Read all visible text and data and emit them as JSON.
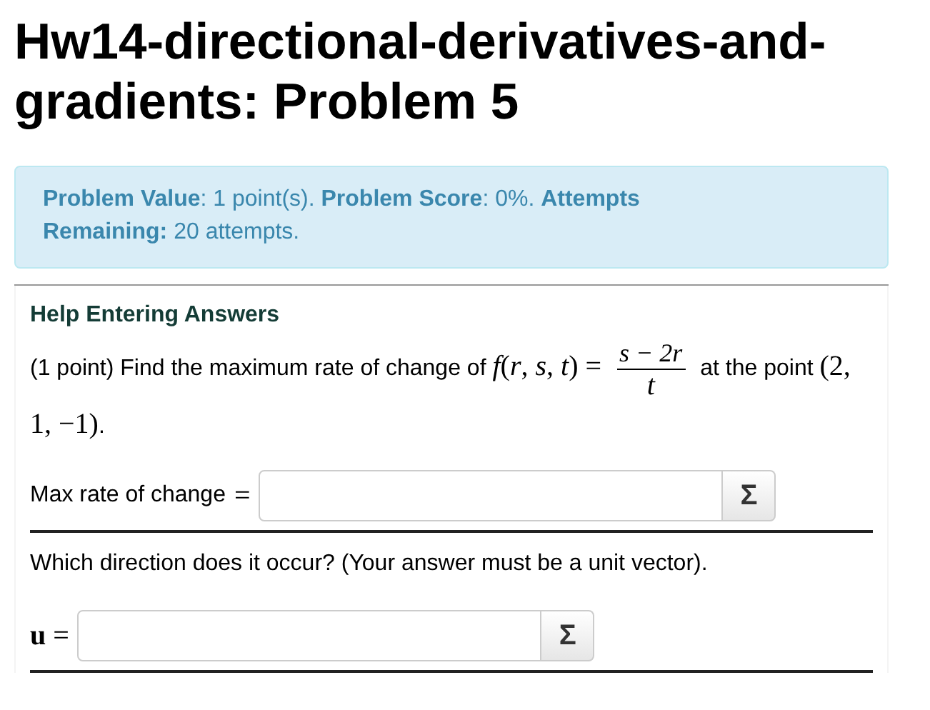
{
  "title": "Hw14-directional-derivatives-and-gradients: Problem 5",
  "status": "**Problem Value**: 1 point(s). **Problem Score**: 0%. **Attempts Remaining:** 20 attempts.",
  "help_link": "Help Entering Answers",
  "problem": {
    "intro": "(1 point) Find the maximum rate of change of",
    "function": "*f*(*r*, *s*, *t*) =",
    "numerator": "s − 2r",
    "denominator": "*t*",
    "middle": "at the point",
    "point": "(2, 1, −1)",
    "end": "."
  },
  "parts": [
    {
      "kind": "answer",
      "label": "Max rate of change",
      "symbol": "=",
      "button": "Σ"
    },
    {
      "kind": "text",
      "text": "Which direction does it occur? (Your answer must be a unit vector)."
    },
    {
      "kind": "answer",
      "symbol": "**u** =",
      "button": "Σ"
    }
  ]
}
